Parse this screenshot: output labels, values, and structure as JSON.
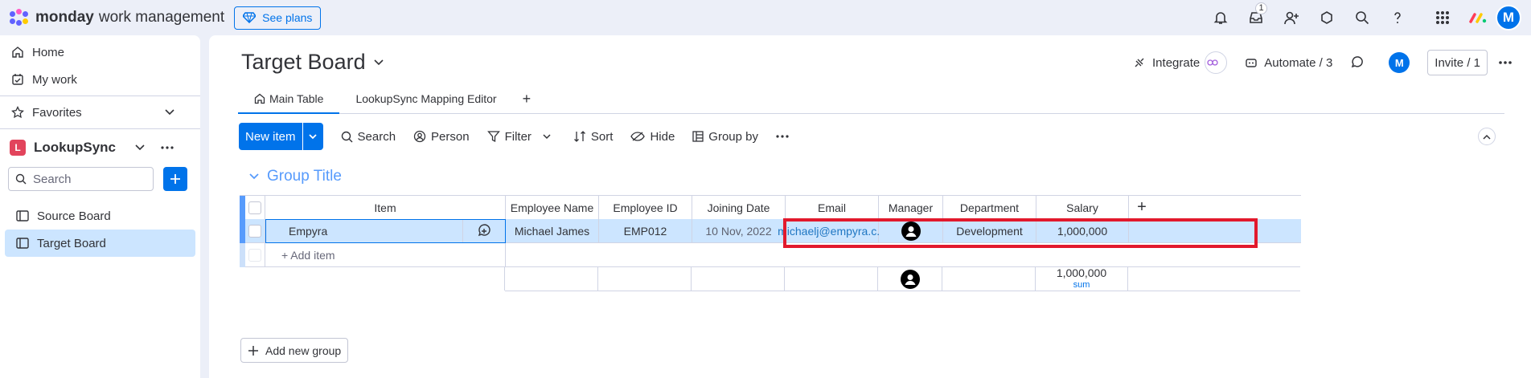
{
  "topbar": {
    "brand_strong": "monday",
    "brand_light": "work management",
    "see_plans": "See plans",
    "inbox_badge": "1",
    "avatar": "M"
  },
  "sidebar": {
    "home": "Home",
    "my_work": "My work",
    "favorites": "Favorites",
    "workspace_letter": "L",
    "workspace_name": "LookupSync",
    "search_placeholder": "Search",
    "boards": [
      "Source Board",
      "Target Board"
    ]
  },
  "board": {
    "title": "Target Board",
    "integrate": "Integrate",
    "automate": "Automate / 3",
    "avatar": "M",
    "invite": "Invite / 1",
    "tabs": [
      "Main Table",
      "LookupSync Mapping Editor"
    ],
    "tab_plus": "+"
  },
  "toolbar": {
    "new_item": "New item",
    "search": "Search",
    "person": "Person",
    "filter": "Filter",
    "sort": "Sort",
    "hide": "Hide",
    "group_by": "Group by"
  },
  "group": {
    "title": "Group Title",
    "columns": [
      "Item",
      "Employee Name",
      "Employee ID",
      "Joining Date",
      "Email",
      "Manager",
      "Department",
      "Salary"
    ],
    "add_column": "+",
    "rows": [
      {
        "item": "Empyra",
        "employee_name": "Michael James",
        "employee_id": "EMP012",
        "joining_date": "10 Nov, 2022",
        "email": "michaelj@empyra.c...",
        "department": "Development",
        "salary": "1,000,000"
      }
    ],
    "add_item": "+ Add item",
    "summary": {
      "salary": "1,000,000",
      "salary_label": "sum"
    }
  },
  "add_group": "Add new group",
  "colors": {
    "primary": "#0073ea",
    "group": "#579bfc",
    "highlight": "#e2192c",
    "selected_row": "#cce5ff"
  }
}
